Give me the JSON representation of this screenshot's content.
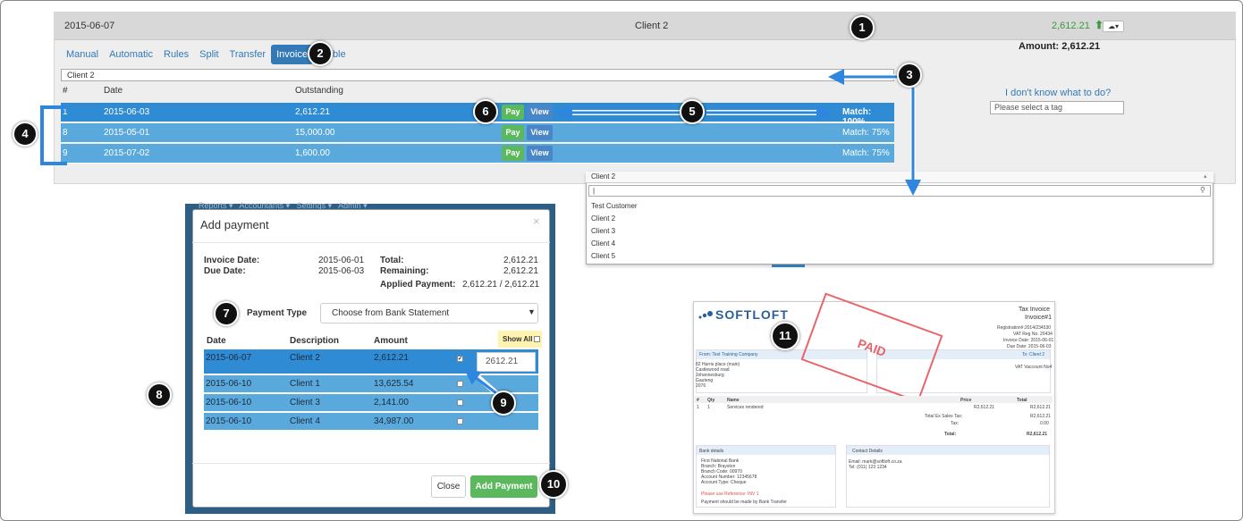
{
  "header": {
    "date": "2015-06-07",
    "client": "Client 2",
    "amount": "2,612.21",
    "amount_label": "Amount: 2,612.21"
  },
  "tabs": [
    {
      "label": "Manual",
      "active": false
    },
    {
      "label": "Automatic",
      "active": false
    },
    {
      "label": "Rules",
      "active": false
    },
    {
      "label": "Split",
      "active": false
    },
    {
      "label": "Transfer",
      "active": false
    },
    {
      "label": "Invoice",
      "active": true
    },
    {
      "label": "ble",
      "active": false
    }
  ],
  "client_select": "Client 2",
  "invoice_table": {
    "headers": [
      "#",
      "Date",
      "Outstanding"
    ],
    "rows": [
      {
        "num": "1",
        "date": "2015-06-03",
        "outstanding": "2,612.21",
        "match": "Match: 100%",
        "pay": "Pay",
        "view": "View"
      },
      {
        "num": "8",
        "date": "2015-05-01",
        "outstanding": "15,000.00",
        "match": "Match: 75%",
        "pay": "Pay",
        "view": "View"
      },
      {
        "num": "9",
        "date": "2015-07-02",
        "outstanding": "1,600.00",
        "match": "Match: 75%",
        "pay": "Pay",
        "view": "View"
      }
    ]
  },
  "tag_help": {
    "link": "I don't know what to do?",
    "placeholder": "Please select a tag"
  },
  "client_dropdown": {
    "selected": "Client 2",
    "search_value": "|",
    "options": [
      "Test Customer",
      "Client 2",
      "Client 3",
      "Client 4",
      "Client 5"
    ]
  },
  "modal": {
    "bg_menu": "Reports ▾   Accountants ▾   Settings ▾   Admin ▾",
    "title": "Add payment",
    "close": "×",
    "invoice_date_label": "Invoice Date:",
    "invoice_date": "2015-06-01",
    "due_date_label": "Due Date:",
    "due_date": "2015-06-03",
    "total_label": "Total:",
    "total": "2,612.21",
    "remaining_label": "Remaining:",
    "remaining": "2,612.21",
    "applied_label": "Applied Payment:",
    "applied": "2,612.21 / 2,612.21",
    "payment_type_label": "Payment Type",
    "payment_type_value": "Choose from Bank Statement",
    "headers": [
      "Date",
      "Description",
      "Amount"
    ],
    "show_all": "Show All",
    "rows": [
      {
        "date": "2015-06-07",
        "desc": "Client 2",
        "amount": "2,612.21",
        "checked": true
      },
      {
        "date": "2015-06-10",
        "desc": "Client 1",
        "amount": "13,625.54",
        "checked": false
      },
      {
        "date": "2015-06-10",
        "desc": "Client 3",
        "amount": "2,141.00",
        "checked": false
      },
      {
        "date": "2015-06-10",
        "desc": "Client 4",
        "amount": "34,987.00",
        "checked": false
      }
    ],
    "applied_input": "2612.21",
    "close_button": "Close",
    "add_button": "Add Payment"
  },
  "invoice_doc": {
    "logo": "SOFTLOFT",
    "title": "Tax Invoice",
    "number": "Invoice#1",
    "meta": [
      "Registration#:2014/234530",
      "VAT Reg No. 20434",
      "Invoice Date: 2015-06-01",
      "Due Date: 2015-06-03"
    ],
    "from_label": "From: Test Training Company",
    "to_label": "To: Client 2",
    "from_address": [
      "82 Harris place (main)",
      "Castlewood road",
      "Johannesburg",
      "Gauteng",
      "2076"
    ],
    "vat_label": "VAT Vaccount No4",
    "stamp": "PAID",
    "line_headers": [
      "#",
      "Qty",
      "Name",
      "Price",
      "Total"
    ],
    "line": [
      "1",
      "1",
      "Services rendered",
      "R2,612.21",
      "R2,612.21"
    ],
    "totals": [
      {
        "label": "Total Ex Sales Tax:",
        "value": "R2,612.21"
      },
      {
        "label": "Tax:",
        "value": "0.00"
      },
      {
        "label": "Total:",
        "value": "R2,612.21"
      }
    ],
    "bank_head": "Bank details",
    "bank": [
      "First National Bank",
      "Branch: Brayston",
      "Branch Code: 00970",
      "Account Number: 12345678",
      "Account Type: Cheque"
    ],
    "bank_ref": "Please use Reference: INV 1",
    "bank_note": "Payment should be made by Bank Transfer",
    "contact_head": "Contact Details",
    "contact": [
      "Email: mark@softloft.co.za",
      "Tel: (011) 123 1234"
    ]
  },
  "callouts": [
    "1",
    "2",
    "3",
    "4",
    "5",
    "6",
    "7",
    "8",
    "9",
    "10",
    "11"
  ],
  "colors": {
    "primary": "#337ab7",
    "row_blue": "#5aa9dd",
    "row_selected": "#2f8bd3",
    "success": "#5cb85c",
    "annotation_blue": "#2e86de"
  }
}
